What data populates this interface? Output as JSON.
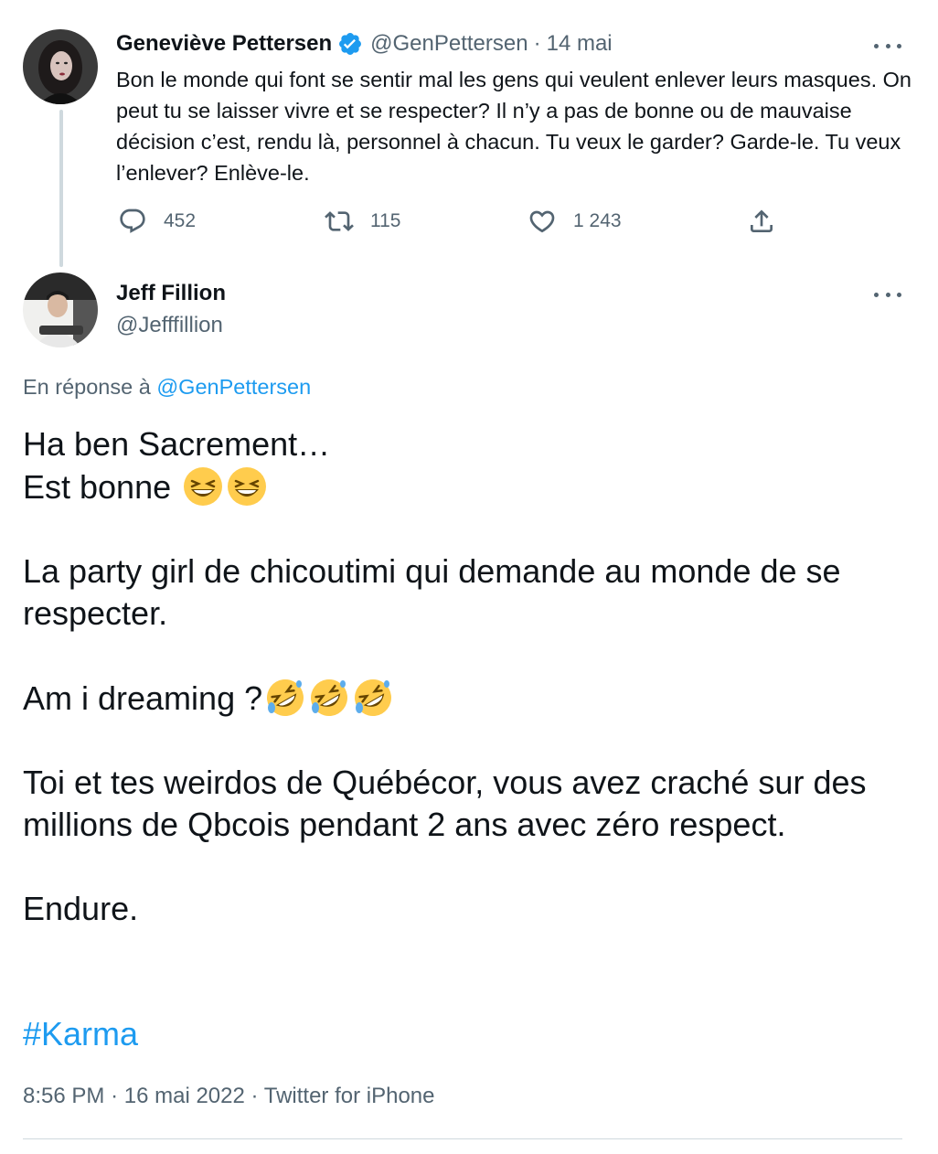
{
  "tweet1": {
    "name": "Geneviève Pettersen",
    "handle": "@GenPettersen",
    "separator": "·",
    "date": "14 mai",
    "text": "Bon le monde qui font se sentir mal les gens qui veulent enlever leurs masques. On peut tu se laisser vivre et se respecter? Il n’y a pas de bonne ou de mauvaise décision c’est, rendu là, personnel à chacun. Tu veux le garder? Garde-le. Tu veux l’enlever? Enlève-le.",
    "replies": "452",
    "retweets": "115",
    "likes": "1 243",
    "icons": {
      "avatar": "user-avatar-icon",
      "verified": "verified-badge-icon",
      "more": "more-options-icon",
      "reply": "reply-icon",
      "retweet": "retweet-icon",
      "like": "heart-icon",
      "share": "share-icon"
    }
  },
  "tweet2": {
    "name": "Jeff Fillion",
    "handle": "@Jefffillion",
    "reply_prefix": "En réponse à",
    "reply_mention": "@GenPettersen",
    "lines": {
      "l1": "Ha ben Sacrement…",
      "l2": "Est bonne",
      "l3": "La party girl de chicoutimi qui demande au monde de se respecter.",
      "l4": "Am i dreaming ?",
      "l5": "Toi et tes weirdos de Québécor, vous avez craché sur des millions de Qbcois pendant 2 ans avec zéro respect.",
      "l6": "Endure."
    },
    "hashtag": "#Karma",
    "time": "8:56 PM",
    "separator": "·",
    "date": "16 mai 2022",
    "source": "Twitter for iPhone",
    "icons": {
      "grin_squint": "grinning-squinting-face-emoji",
      "rofl": "rolling-on-floor-laughing-emoji"
    }
  },
  "colors": {
    "text": "#0f1419",
    "secondary": "#536471",
    "link": "#1d9bf0",
    "border": "#cfd9de"
  }
}
